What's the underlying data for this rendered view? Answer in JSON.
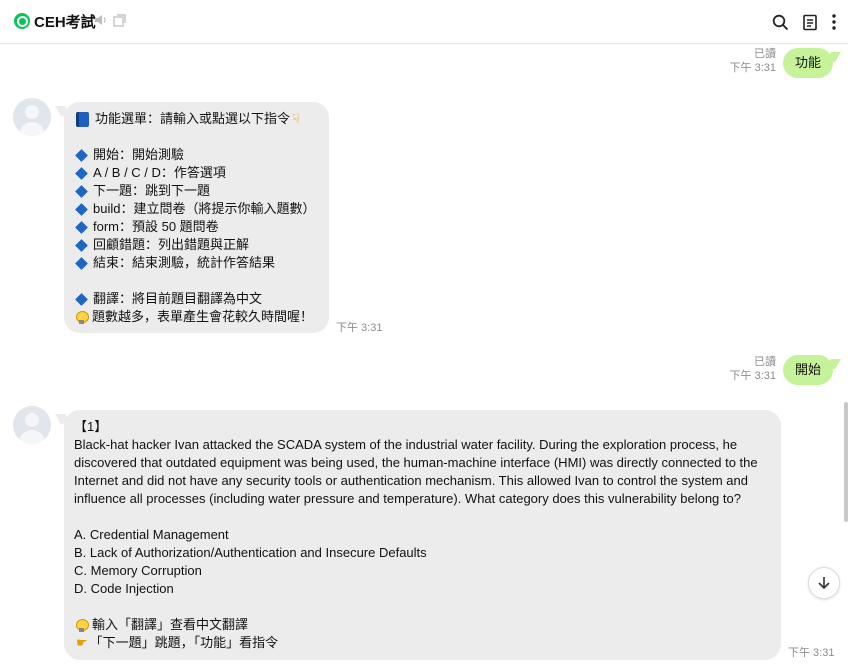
{
  "header": {
    "title": "CEH考試",
    "icons": [
      "mute-icon",
      "popout-icon",
      "search-icon",
      "notes-icon",
      "more-icon"
    ]
  },
  "messages": {
    "out1": {
      "text": "功能",
      "read": "已讀",
      "time": "下午 3:31"
    },
    "menu": {
      "lines": [
        {
          "icon": "book",
          "text": "功能選單：請輸入或點選以下指令"
        },
        {
          "icon": "",
          "text": ""
        },
        {
          "icon": "diamond",
          "text": "開始：開始測驗"
        },
        {
          "icon": "diamond",
          "text": "A / B / C / D：作答選項"
        },
        {
          "icon": "diamond",
          "text": "下一題：跳到下一題"
        },
        {
          "icon": "diamond",
          "text": "build：建立問卷（將提示你輸入題數）"
        },
        {
          "icon": "diamond",
          "text": "form：預設 50 題問卷"
        },
        {
          "icon": "diamond",
          "text": "回顧錯題：列出錯題與正解"
        },
        {
          "icon": "diamond",
          "text": "結束：結束測驗，統計作答結果"
        },
        {
          "icon": "",
          "text": ""
        },
        {
          "icon": "diamond",
          "text": "翻譯：將目前題目翻譯為中文"
        },
        {
          "icon": "bulb",
          "text": "題數越多，表單產生會花較久時間喔！"
        }
      ],
      "time": "下午 3:31"
    },
    "out2": {
      "text": "開始",
      "read": "已讀",
      "time": "下午 3:31"
    },
    "question": {
      "number": "【1】",
      "body": "Black-hat hacker Ivan attacked the SCADA system of the industrial water facility. During the exploration process, he discovered that outdated equipment was being used, the human-machine interface (HMI) was directly connected to the Internet and did not have any security tools or authentication mechanism. This allowed Ivan to control the system and influence all processes (including water pressure and temperature). What category does this vulnerability belong to?",
      "options": [
        "A. Credential Management",
        "B. Lack of Authorization/Authentication and Insecure Defaults",
        "C. Memory Corruption",
        "D. Code Injection"
      ],
      "hint1": "輸入「翻譯」查看中文翻譯",
      "hint2": "「下一題」跳題，「功能」看指令",
      "time": "下午 3:31"
    }
  }
}
